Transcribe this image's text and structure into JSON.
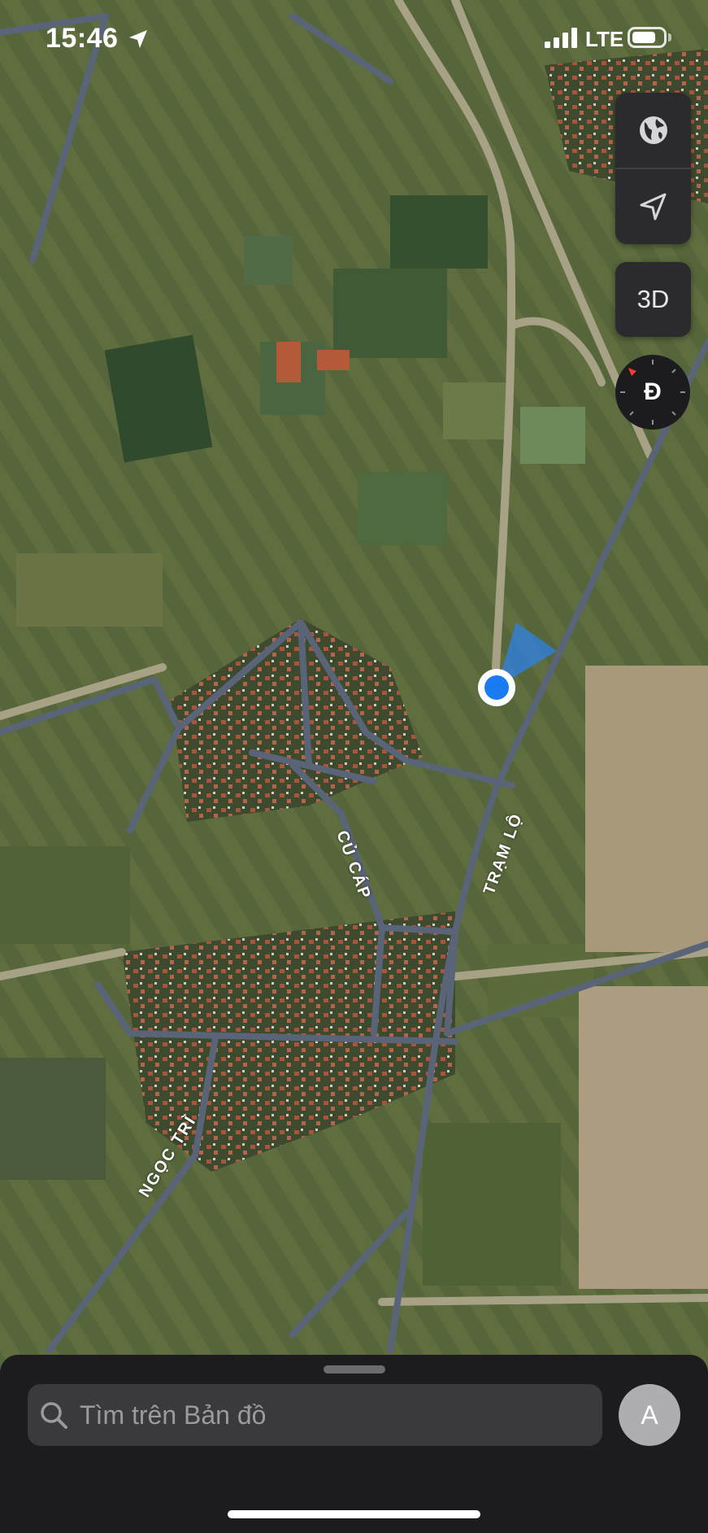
{
  "status_bar": {
    "time": "15:46",
    "network": "LTE"
  },
  "map_controls": {
    "map_mode_icon": "globe-icon",
    "tracking_icon": "location-arrow-icon",
    "view_3d_label": "3D",
    "compass_label": "Đ"
  },
  "road_labels": {
    "cu_cap": "CỦ CÁP",
    "tram_lo": "TRẠM LỘ",
    "ngoc_tri": "NGỌC TRÌ"
  },
  "colors": {
    "fields_light": "#5d6b3c",
    "fields_dark": "#3f5230",
    "roads": "#5a6478",
    "location_dot": "#1a7cf2",
    "bare_land": "#a8997a"
  },
  "bottom_sheet": {
    "search_placeholder": "Tìm trên Bản đồ",
    "avatar_initial": "A"
  }
}
